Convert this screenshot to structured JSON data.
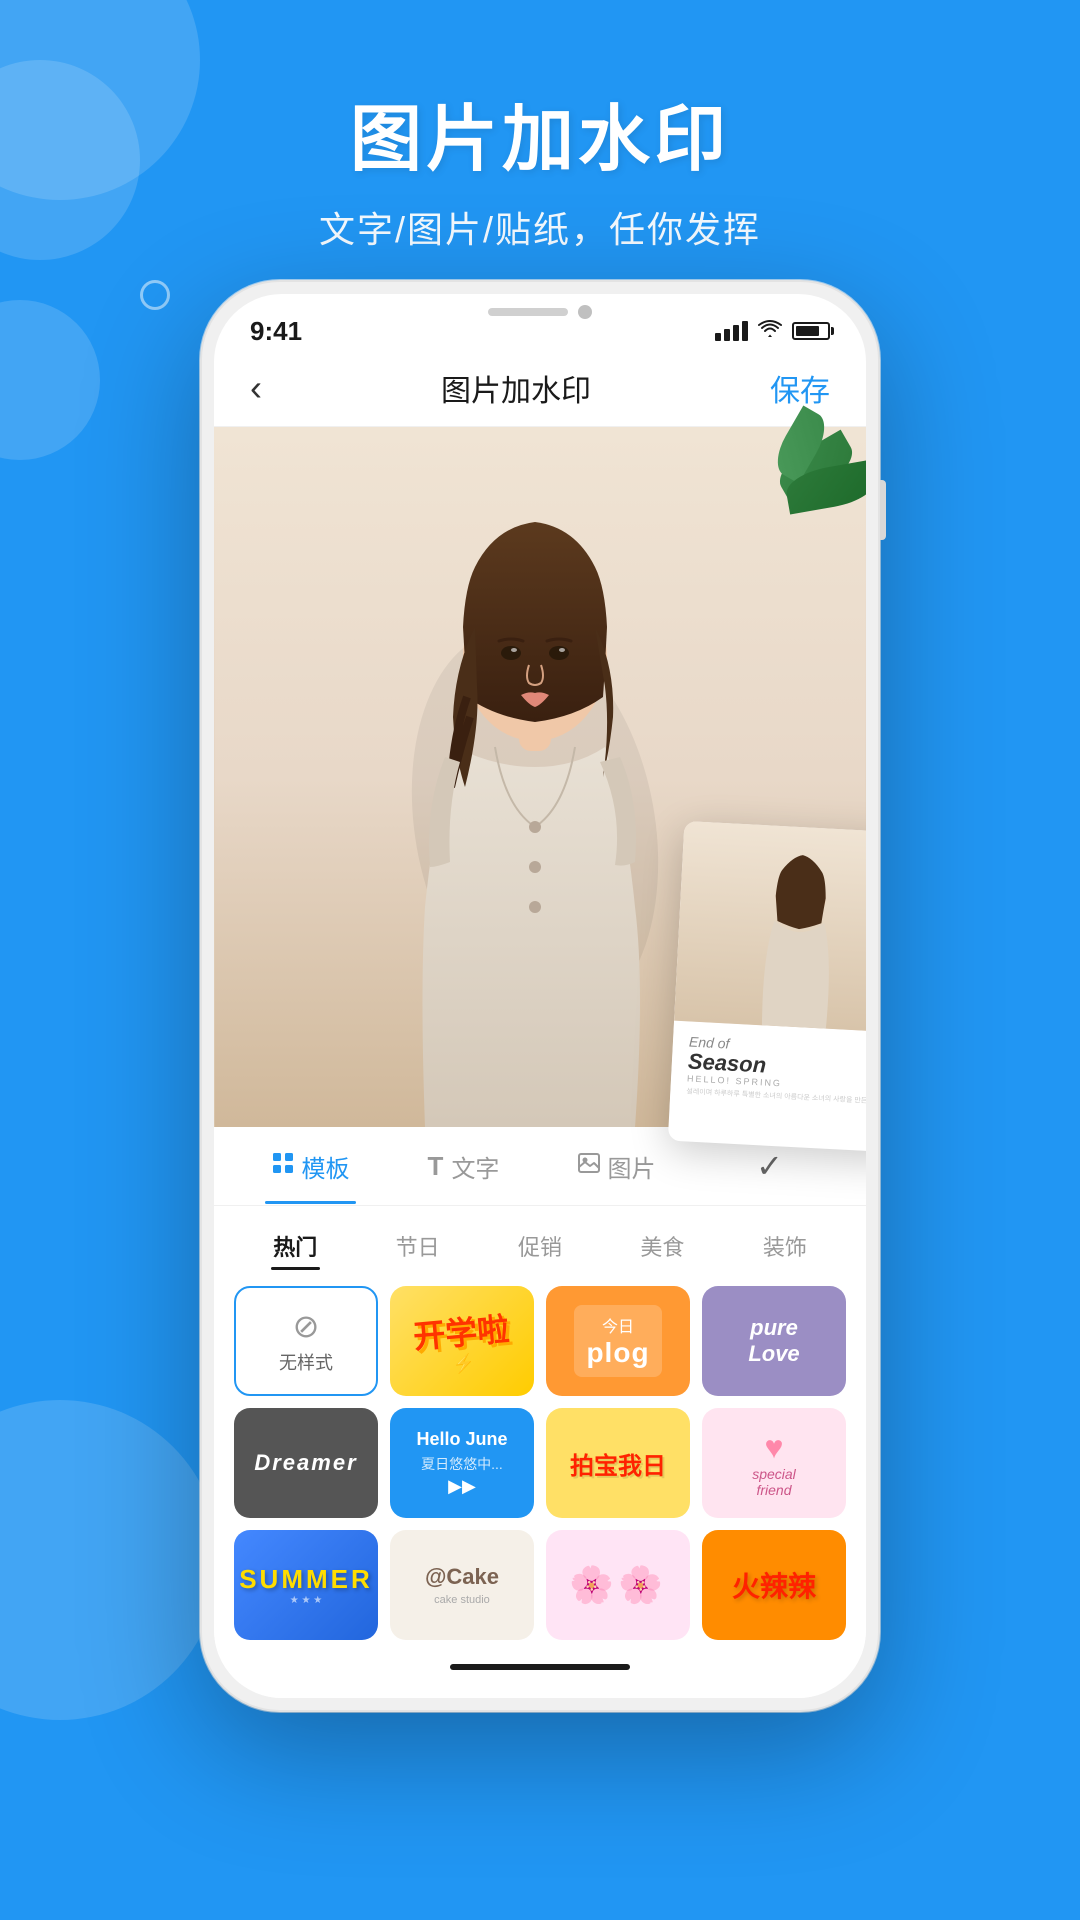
{
  "background": {
    "color": "#2196F3"
  },
  "header": {
    "title": "图片加水印",
    "subtitle": "文字/图片/贴纸，任你发挥"
  },
  "phone": {
    "status_bar": {
      "time": "9:41",
      "signal": "●●●●",
      "wifi": "wifi",
      "battery": "75"
    },
    "nav": {
      "back": "‹",
      "title": "图片加水印",
      "save": "保存"
    },
    "tabs": [
      {
        "label": "模板",
        "icon": "grid",
        "active": true
      },
      {
        "label": "文字",
        "icon": "T",
        "active": false
      },
      {
        "label": "图片",
        "icon": "image",
        "active": false
      },
      {
        "label": "check",
        "icon": "✓",
        "active": false
      }
    ],
    "categories": [
      {
        "label": "热门",
        "active": true
      },
      {
        "label": "节日",
        "active": false
      },
      {
        "label": "促销",
        "active": false
      },
      {
        "label": "美食",
        "active": false
      },
      {
        "label": "装饰",
        "active": false
      }
    ],
    "preview_card": {
      "end_of": "End of",
      "season": "Season",
      "hello": "HELLO! SPRING",
      "small_text": "설레이며 하루하루 특별한 소녀의 아름다운 소녀의\n사랑을 만든다"
    },
    "stickers": [
      {
        "id": "no-style",
        "label": "无样式",
        "type": "no-style"
      },
      {
        "id": "kaixuela",
        "label": "开学啦",
        "type": "kaixuela"
      },
      {
        "id": "plog",
        "label": "今日plog",
        "type": "plog"
      },
      {
        "id": "purelove",
        "label": "pureLove",
        "type": "purelove"
      },
      {
        "id": "dreamer",
        "label": "Dreamer",
        "type": "dreamer"
      },
      {
        "id": "hellojune",
        "label": "Hello June",
        "type": "hellojune"
      },
      {
        "id": "paibao",
        "label": "拍宝我日",
        "type": "paibao"
      },
      {
        "id": "special",
        "label": "special friend",
        "type": "special"
      },
      {
        "id": "summer",
        "label": "SUMMER",
        "type": "summer"
      },
      {
        "id": "cake",
        "label": "@Cake",
        "type": "cake"
      },
      {
        "id": "flowers",
        "label": "花花",
        "type": "flowers"
      },
      {
        "id": "spicy",
        "label": "火辣辣",
        "type": "spicy"
      }
    ]
  }
}
